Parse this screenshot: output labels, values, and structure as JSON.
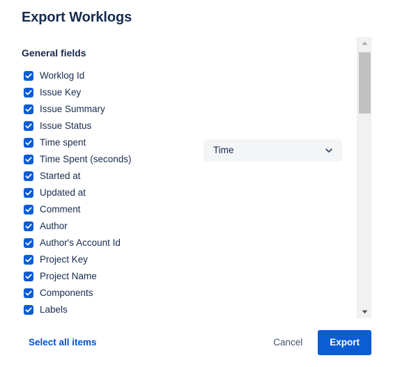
{
  "dialog": {
    "title": "Export Worklogs",
    "section_heading": "General fields"
  },
  "fields": [
    {
      "label": "Worklog Id",
      "checked": true
    },
    {
      "label": "Issue Key",
      "checked": true
    },
    {
      "label": "Issue Summary",
      "checked": true
    },
    {
      "label": "Issue Status",
      "checked": true
    },
    {
      "label": "Time spent",
      "checked": true
    },
    {
      "label": "Time Spent (seconds)",
      "checked": true
    },
    {
      "label": "Started at",
      "checked": true
    },
    {
      "label": "Updated at",
      "checked": true
    },
    {
      "label": "Comment",
      "checked": true
    },
    {
      "label": "Author",
      "checked": true
    },
    {
      "label": "Author's Account Id",
      "checked": true
    },
    {
      "label": "Project Key",
      "checked": true
    },
    {
      "label": "Project Name",
      "checked": true
    },
    {
      "label": "Components",
      "checked": true
    },
    {
      "label": "Labels",
      "checked": true
    }
  ],
  "time_format_select": {
    "value": "Time",
    "icon": "chevron-down-icon"
  },
  "scrollbar": {
    "up_icon": "triangle-up-icon",
    "down_icon": "triangle-down-icon"
  },
  "footer": {
    "select_all_label": "Select all items",
    "cancel_label": "Cancel",
    "export_label": "Export"
  },
  "colors": {
    "primary": "#0B5CD5",
    "link": "#0052CC",
    "text": "#172B4D",
    "subtle_text": "#42526E",
    "select_bg": "#F4F5F7",
    "scrollbar_track": "#F1F1F1",
    "scrollbar_thumb": "#C1C1C1"
  }
}
